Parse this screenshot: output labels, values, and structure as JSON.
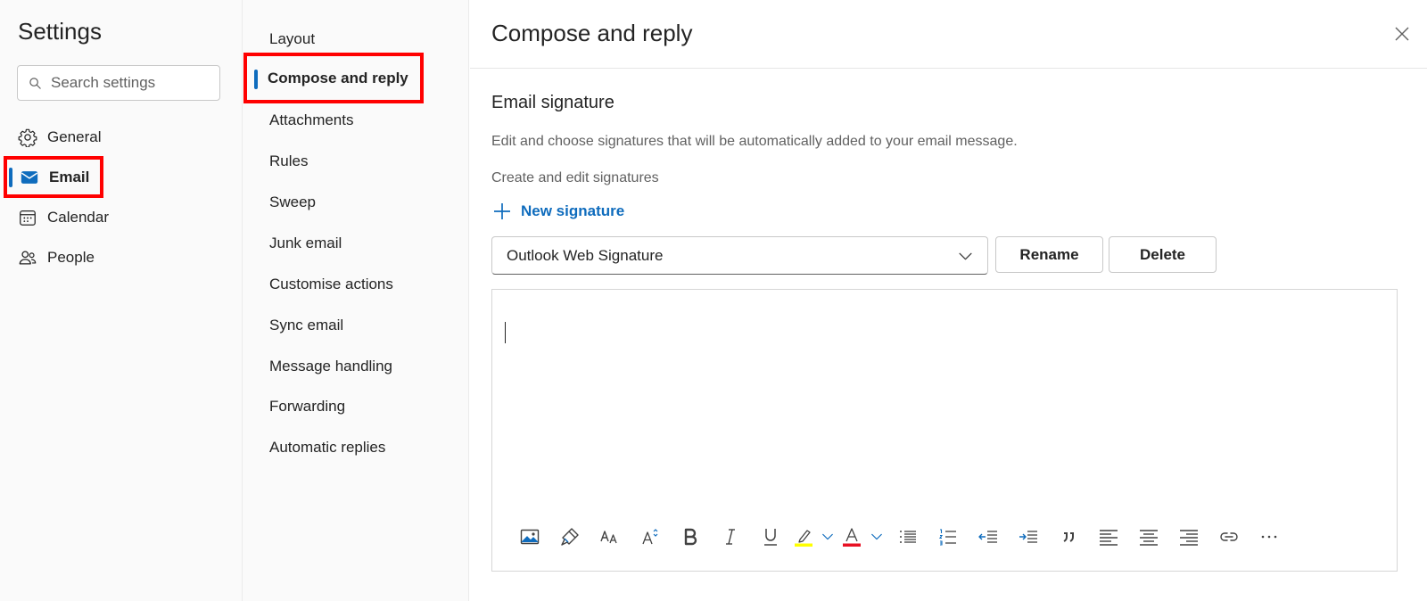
{
  "settings": {
    "title": "Settings",
    "search_placeholder": "Search settings"
  },
  "nav": {
    "items": [
      {
        "label": "General",
        "icon": "gear-icon"
      },
      {
        "label": "Email",
        "icon": "mail-icon",
        "selected": true
      },
      {
        "label": "Calendar",
        "icon": "calendar-icon"
      },
      {
        "label": "People",
        "icon": "people-icon"
      }
    ]
  },
  "subnav": {
    "items": [
      {
        "label": "Layout"
      },
      {
        "label": "Compose and reply",
        "selected": true
      },
      {
        "label": "Attachments"
      },
      {
        "label": "Rules"
      },
      {
        "label": "Sweep"
      },
      {
        "label": "Junk email"
      },
      {
        "label": "Customise actions"
      },
      {
        "label": "Sync email"
      },
      {
        "label": "Message handling"
      },
      {
        "label": "Forwarding"
      },
      {
        "label": "Automatic replies"
      }
    ]
  },
  "panel": {
    "title": "Compose and reply",
    "section_title": "Email signature",
    "section_description": "Edit and choose signatures that will be automatically added to your email message.",
    "section_subtitle": "Create and edit signatures",
    "new_signature_label": "New signature",
    "signature_selected": "Outlook Web Signature",
    "rename_label": "Rename",
    "delete_label": "Delete"
  },
  "toolbar_icons": [
    "insert-image-icon",
    "format-painter-icon",
    "font-icon",
    "font-size-icon",
    "bold-icon",
    "italic-icon",
    "underline-icon",
    "highlight-icon",
    "chevron-down-icon",
    "font-color-icon",
    "chevron-down-icon",
    "bullets-icon",
    "numbering-icon",
    "decrease-indent-icon",
    "increase-indent-icon",
    "quote-icon",
    "align-left-icon",
    "align-center-icon",
    "align-right-icon",
    "link-icon",
    "more-options-icon"
  ],
  "colors": {
    "accent": "#0f6cbd",
    "highlight_box": "#ff0000",
    "highlight_yellow": "#ffff00",
    "font_color_red": "#e81123"
  }
}
